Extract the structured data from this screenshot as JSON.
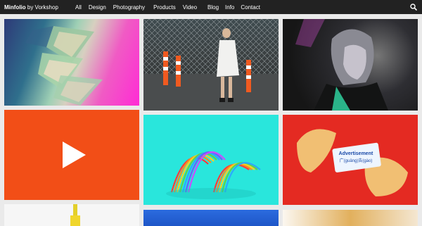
{
  "header": {
    "brand_name": "Minfolio",
    "brand_suffix": " by Vorkshop",
    "nav_filters": [
      "All",
      "Design",
      "Photography",
      "Products",
      "Video"
    ],
    "nav_pages": [
      "Blog",
      "Info",
      "Contact"
    ],
    "search_icon": "search-icon"
  },
  "grid": {
    "video_tile_icon": "play-icon",
    "ad_tile": {
      "title": "Advertisement",
      "subtitle": "广(guǎng)告(gào)"
    }
  },
  "colors": {
    "topbar": "#222222",
    "video_tile": "#f24e17",
    "slinky_bg": "#29e6dc",
    "fortune_bg": "#e42a22"
  }
}
